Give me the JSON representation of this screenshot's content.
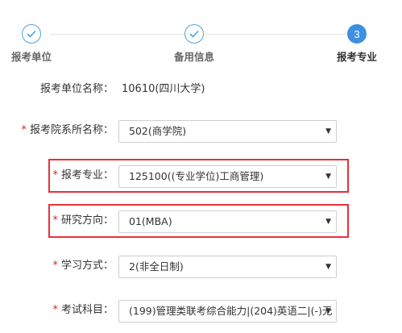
{
  "steps": [
    {
      "label": "报考单位",
      "status": "done",
      "icon": "check-icon"
    },
    {
      "label": "备用信息",
      "status": "done",
      "icon": "check-icon"
    },
    {
      "label": "报考专业",
      "status": "active",
      "number": "3"
    }
  ],
  "form": {
    "unit": {
      "label": "报考单位名称：",
      "value": "10610(四川大学)"
    },
    "department": {
      "label": "报考院系所名称：",
      "value": "502(商学院)"
    },
    "major": {
      "label": "报考专业：",
      "value": "125100((专业学位)工商管理)"
    },
    "direction": {
      "label": "研究方向：",
      "value": "01(MBA)"
    },
    "study_mode": {
      "label": "学习方式：",
      "value": "2(非全日制)"
    },
    "exam_subjects": {
      "label": "考试科目：",
      "value": "(199)管理类联考综合能力|(204)英语二|(-)无"
    }
  },
  "required_mark": "*",
  "dropdown_icon": "caret-down-icon",
  "colors": {
    "accent": "#3d8fe0",
    "highlight": "#e8303a",
    "required": "#e02020"
  }
}
